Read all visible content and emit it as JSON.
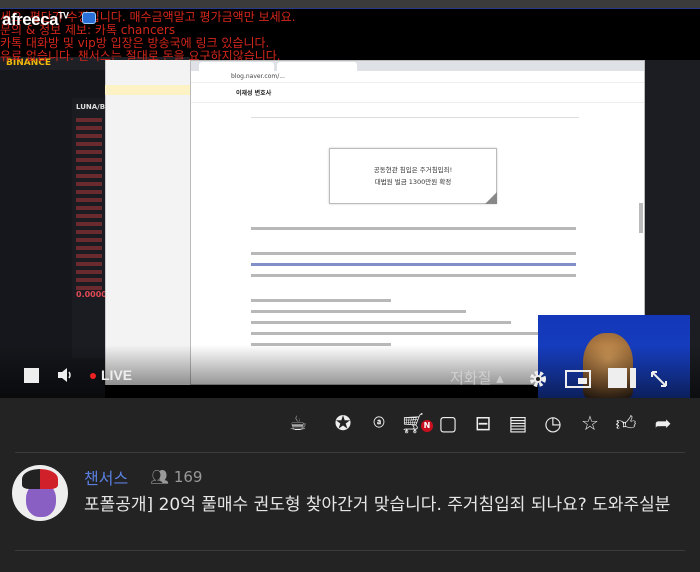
{
  "video": {
    "logo": "afreecaTV",
    "notices": [
      "세요. 평단가 수정입니다. 매수금액말고 평가금액만 보세요.",
      "문의 & 정보 제보: 카톡 chancers",
      "카톡 대화방 및 vip방 입장은 방송국에 링크 있습니다.",
      "유료 없습니다. 챈서스는 절대로 돈을 요구하지않습니다."
    ],
    "binance": {
      "logo": "BINANCE",
      "pair": "LUNA/B",
      "last_price": "0.00000"
    },
    "browser": {
      "url": "blog.naver.com/...",
      "blog_title": "이재성 변호사",
      "callout_line1": "공동현관 침입은 주거침입죄!",
      "callout_line2": "대법원 벌금 1300만원 확정"
    }
  },
  "controls": {
    "status": "LIVE",
    "quality": "저화질 ▴",
    "live_color": "#e22222"
  },
  "toolbar": {
    "icons": [
      "mug-star-icon",
      "balloon-star-icon",
      "ad-balloon-icon",
      "cart-icon",
      "sticker-icon",
      "archive-icon",
      "clapperboard-icon",
      "clock-icon",
      "star-icon",
      "thumbs-up-icon",
      "share-icon"
    ],
    "new_badge": "N"
  },
  "stream": {
    "broadcaster": "챈서스",
    "viewers": "169",
    "title": "포폴공개] 20억 풀매수 권도형 찾아간거 맞습니다. 주거침입죄 되나요? 도와주실분",
    "name_color": "#5a7fe0"
  }
}
